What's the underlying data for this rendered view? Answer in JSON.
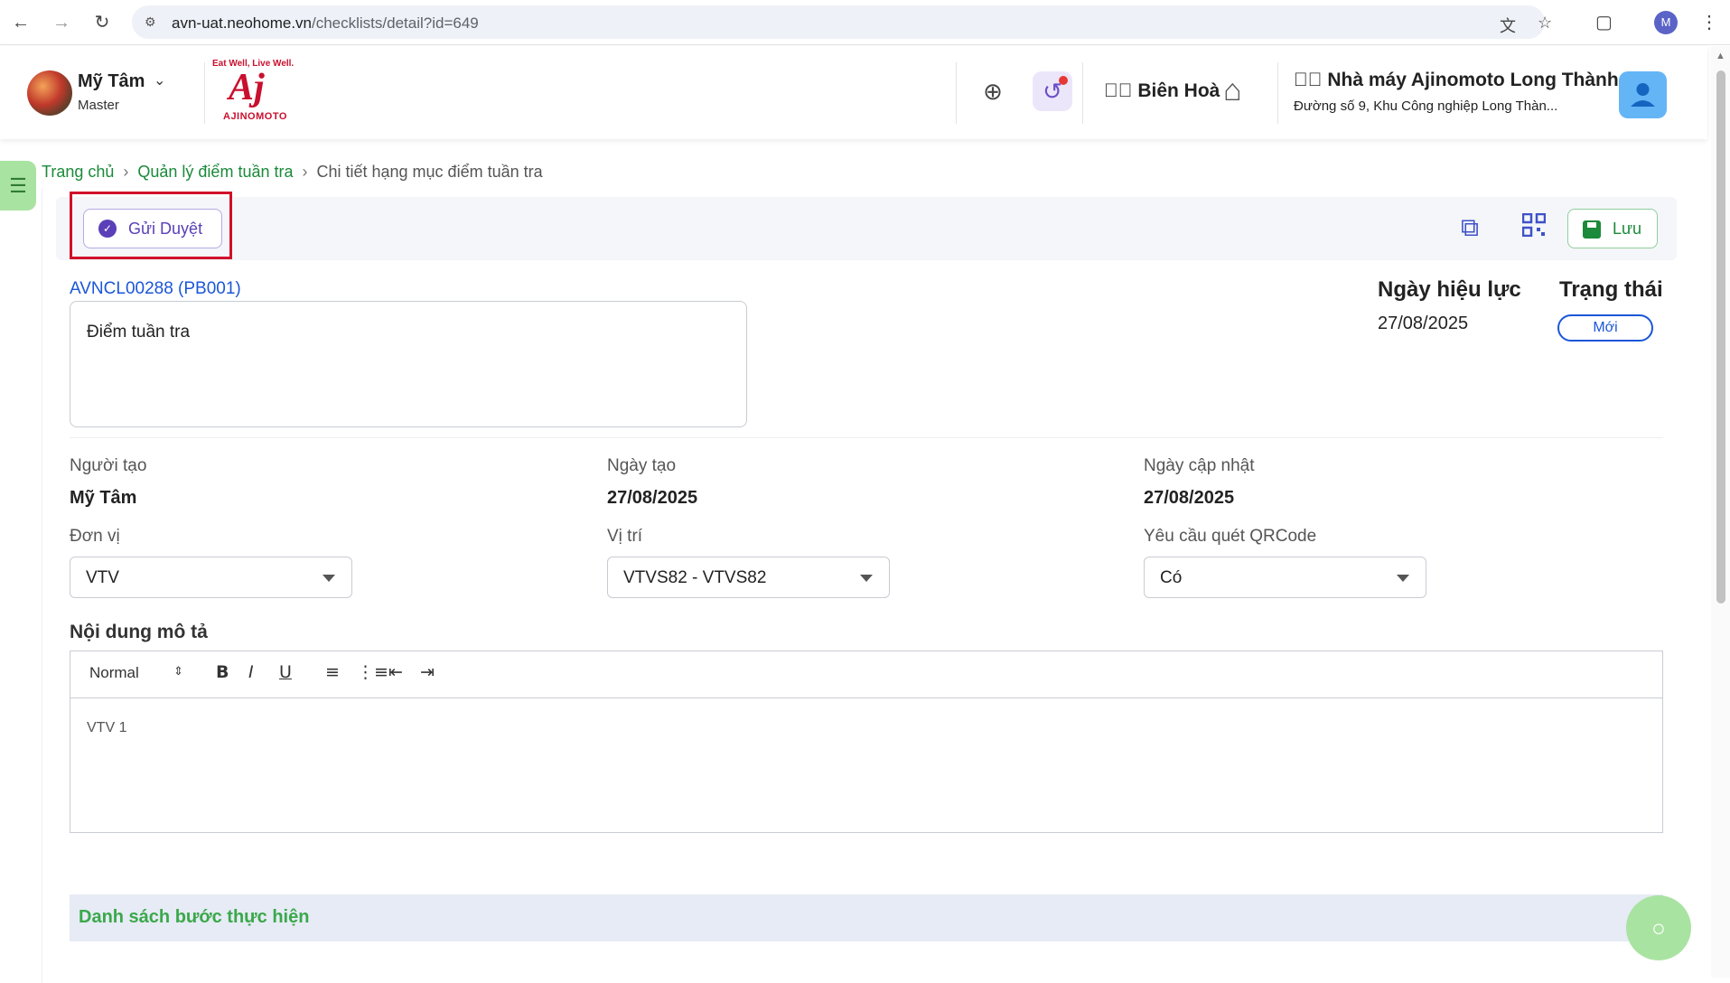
{
  "browser": {
    "url_host": "avn-uat.neohome.vn",
    "url_path": "/checklists/detail?id=649",
    "profile_initial": "M",
    "icons": [
      "back-icon",
      "forward-icon",
      "reload-icon",
      "site-info-icon",
      "translate-icon",
      "bookmark-star-icon",
      "extensions-icon",
      "menu-kebab-icon"
    ]
  },
  "header": {
    "user_name": "Mỹ Tâm",
    "user_role": "Master",
    "logo_tagline": "Eat Well, Live Well.",
    "logo_mark": "Aj",
    "logo_brand": "AJINOMOTO",
    "location": "Biên Hoà",
    "factory_name": "Nhà máy Ajinomoto Long Thành",
    "factory_address": "Đường số 9, Khu Công nghiệp Long Thàn..."
  },
  "breadcrumb": {
    "home": "Trang chủ",
    "section": "Quản lý điểm tuần tra",
    "current": "Chi tiết hạng mục điểm tuần tra"
  },
  "toolbar": {
    "submit_label": "Gửi Duyệt",
    "save_label": "Lưu"
  },
  "detail": {
    "code": "AVNCL00288 (PB001)",
    "name": "Điểm tuần tra",
    "effective_label": "Ngày hiệu lực",
    "effective_date": "27/08/2025",
    "status_label": "Trạng thái",
    "status_value": "Mới"
  },
  "fields": {
    "creator_label": "Người tạo",
    "creator_value": "Mỹ Tâm",
    "created_label": "Ngày tạo",
    "created_value": "27/08/2025",
    "updated_label": "Ngày cập nhật",
    "updated_value": "27/08/2025",
    "unit_label": "Đơn vị",
    "unit_value": "VTV",
    "position_label": "Vị trí",
    "position_value": "VTVS82 - VTVS82",
    "qr_label": "Yêu cầu quét QRCode",
    "qr_value": "Có"
  },
  "description": {
    "title": "Nội dung mô tả",
    "format": "Normal",
    "body": "VTV 1"
  },
  "steps": {
    "title": "Danh sách bước thực hiện"
  }
}
